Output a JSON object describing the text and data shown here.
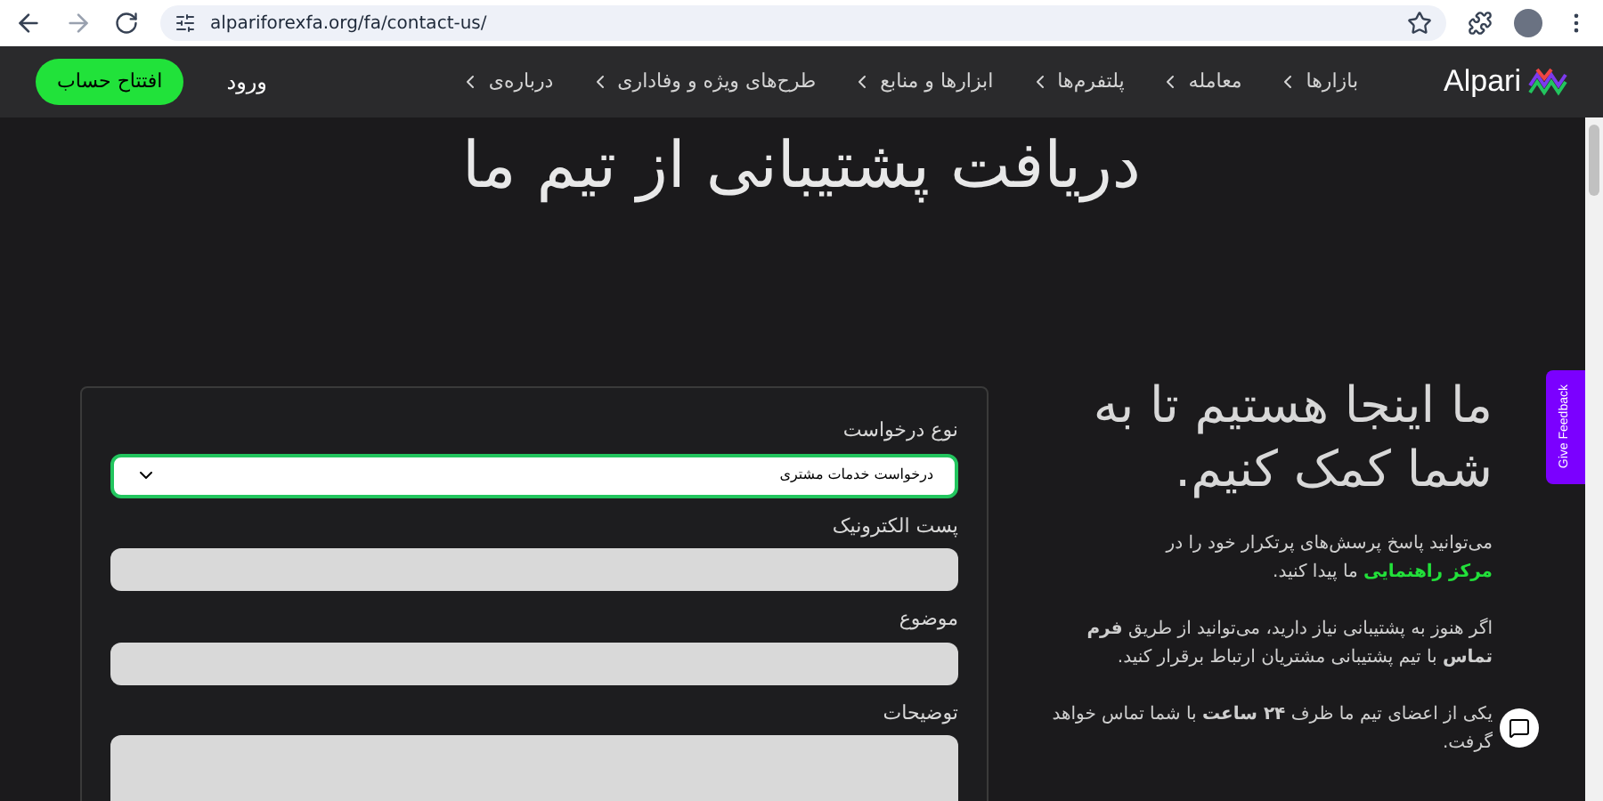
{
  "browser": {
    "url": "alpariforexfa.org/fa/contact-us/"
  },
  "header": {
    "logo": "Alpari",
    "nav": [
      "بازارها",
      "معامله",
      "پلتفرم‌ها",
      "ابزارها و منابع",
      "طرح‌های ویژه و وفاداری",
      "درباره‌ی"
    ],
    "login": "ورود",
    "signup": "افتتاح حساب"
  },
  "title": "دریافت پشتیبانی از تیم ما",
  "intro": {
    "heading": "ما اینجا هستیم تا به شما کمک کنیم.",
    "paragraphs": [
      {
        "kind": "link",
        "before": "می‌توانید پاسخ پرسش‌های پرتکرار خود را در ",
        "link": "مرکز راهنمایی",
        "after": " ما پیدا کنید."
      },
      {
        "kind": "text",
        "text": "اگر هنوز به پشتیبانی نیاز دارید، می‌توانید از طریق **فرم تماس** با تیم پشتیبانی مشتریان ارتباط برقرار کنید."
      },
      {
        "kind": "text",
        "text": "یکی از اعضای تیم ما ظرف **۲۴ ساعت** با شما تماس خواهد گرفت."
      }
    ]
  },
  "form": {
    "fields": [
      {
        "kind": "select",
        "label": "نوع درخواست",
        "value": "درخواست خدمات مشتری"
      },
      {
        "kind": "input",
        "label": "پست الکترونیک"
      },
      {
        "kind": "input",
        "label": "موضوع"
      },
      {
        "kind": "textarea",
        "label": "توضیحات"
      }
    ]
  },
  "feedback_tab": "Give Feedback"
}
